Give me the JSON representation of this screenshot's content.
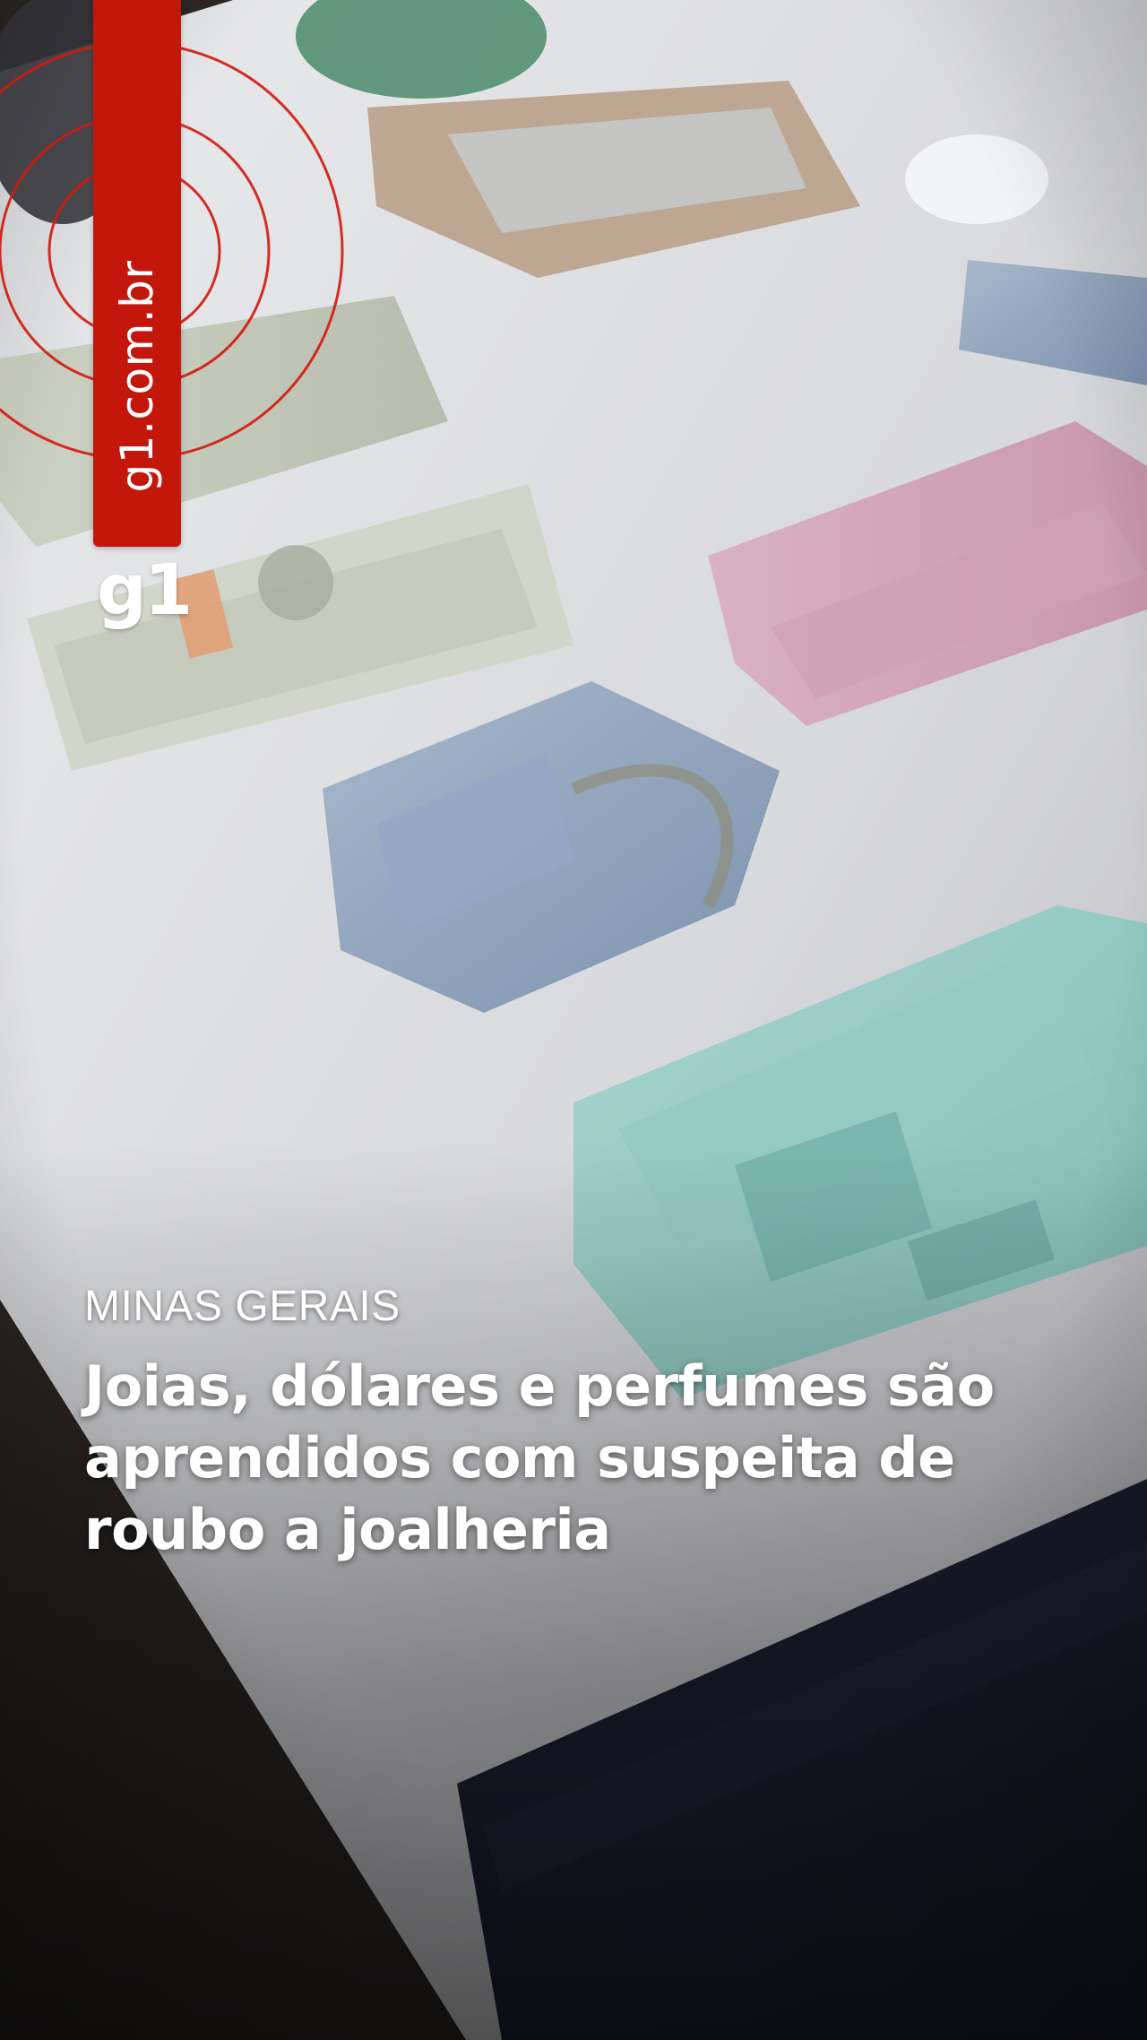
{
  "brand": {
    "site_url": "g1.com.br",
    "logo_text": "g1",
    "accent_color": "#c4170c"
  },
  "story": {
    "section": "MINAS GERAIS",
    "headline": "Joias, dólares e perfumes são aprendidos com suspeita de roubo a joalheria"
  }
}
